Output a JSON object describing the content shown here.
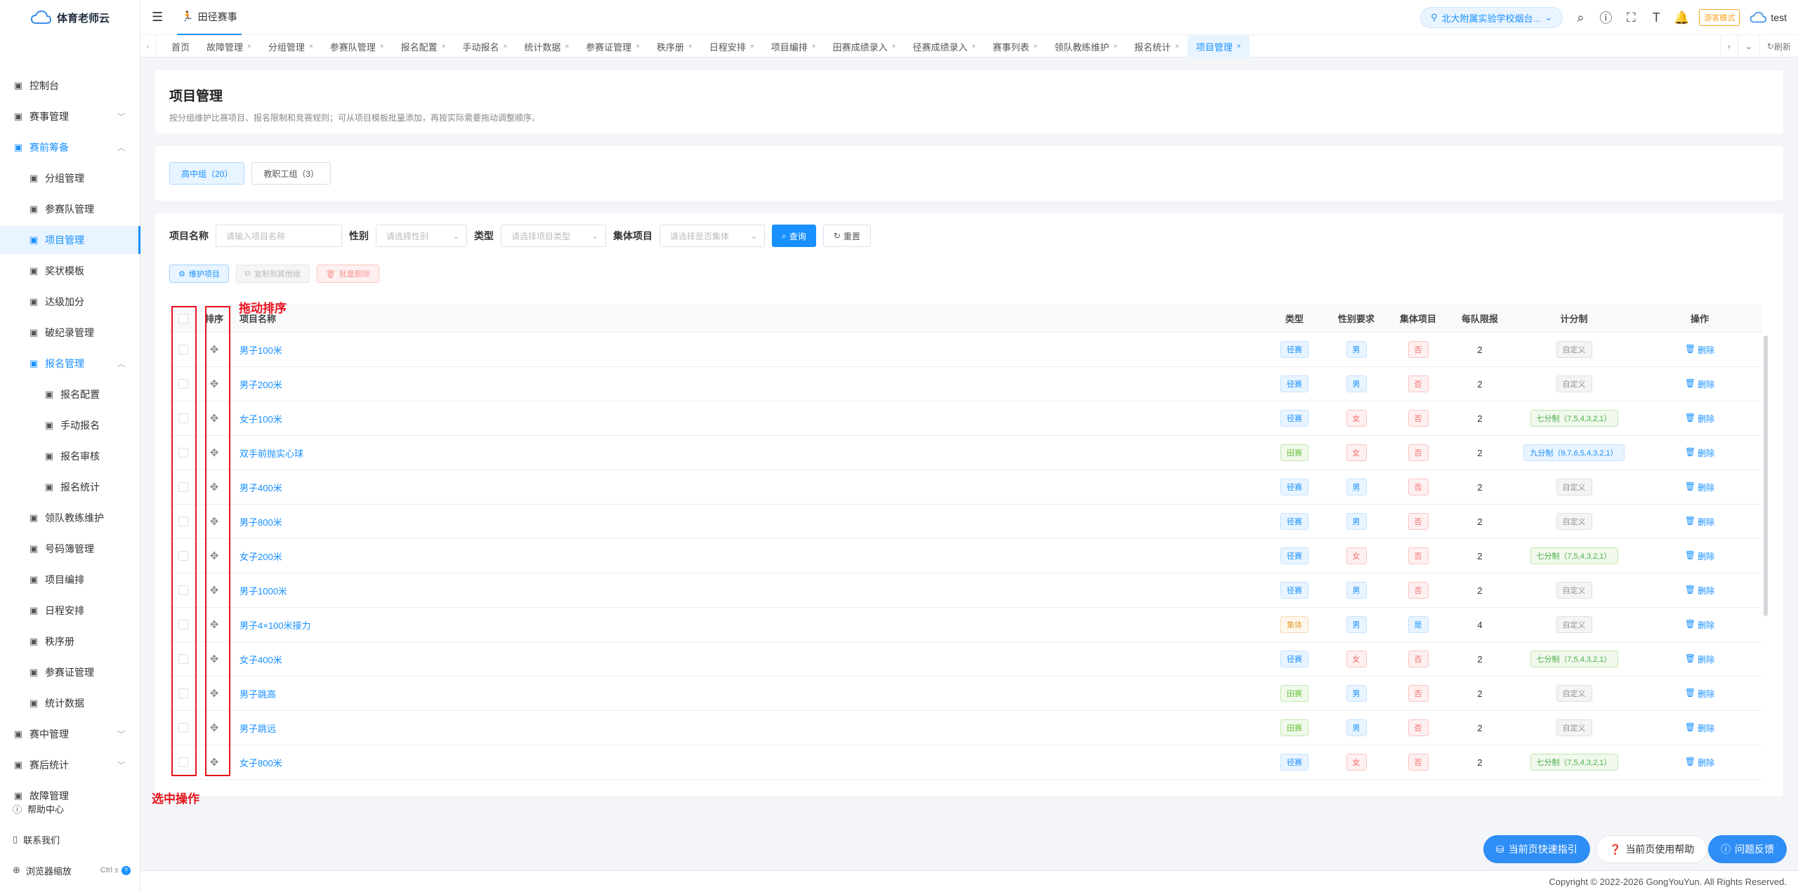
{
  "app": {
    "name": "体育老师云"
  },
  "sidebar": {
    "items": [
      {
        "label": "控制台",
        "icon": "dashboard-icon"
      },
      {
        "label": "赛事管理",
        "icon": "trophy-icon",
        "chevron": "﹀"
      },
      {
        "label": "赛前筹备",
        "icon": "document-icon",
        "chevron": "︿"
      },
      {
        "label": "分组管理",
        "icon": "group-icon"
      },
      {
        "label": "参赛队管理",
        "icon": "team-icon"
      },
      {
        "label": "项目管理",
        "icon": "doc-icon"
      },
      {
        "label": "奖状模板",
        "icon": "certificate-icon"
      },
      {
        "label": "达级加分",
        "icon": "chart-line-icon"
      },
      {
        "label": "破纪录管理",
        "icon": "record-icon"
      },
      {
        "label": "报名管理",
        "icon": "form-icon",
        "chevron": "︿"
      },
      {
        "label": "报名配置",
        "icon": "config-icon"
      },
      {
        "label": "手动报名",
        "icon": "hand-icon"
      },
      {
        "label": "报名审核",
        "icon": "audit-icon"
      },
      {
        "label": "报名统计",
        "icon": "stat-doc-icon"
      },
      {
        "label": "领队教练维护",
        "icon": "coach-icon"
      },
      {
        "label": "号码簿管理",
        "icon": "bib-icon"
      },
      {
        "label": "项目编排",
        "icon": "list-icon"
      },
      {
        "label": "日程安排",
        "icon": "calendar-icon"
      },
      {
        "label": "秩序册",
        "icon": "book-icon"
      },
      {
        "label": "参赛证管理",
        "icon": "card-icon"
      },
      {
        "label": "统计数据",
        "icon": "bar-chart-icon"
      },
      {
        "label": "赛中管理",
        "icon": "clock-icon",
        "chevron": "﹀"
      },
      {
        "label": "赛后统计",
        "icon": "stats-icon",
        "chevron": "﹀"
      },
      {
        "label": "故障管理",
        "icon": "bug-icon"
      }
    ],
    "bottom": {
      "help": "帮助中心",
      "contact": "联系我们",
      "zoom": "浏览器缩放",
      "zoom_shortcut": "Ctrl ±",
      "zoom_help": "?"
    }
  },
  "header": {
    "breadcrumb": "田径赛事",
    "school": "北大附属实验学校烟台...",
    "mode_badge": "游客模式",
    "user": "test"
  },
  "tabs": {
    "items": [
      "首页",
      "故障管理",
      "分组管理",
      "参赛队管理",
      "报名配置",
      "手动报名",
      "统计数据",
      "参赛证管理",
      "秩序册",
      "日程安排",
      "项目编排",
      "田赛成绩录入",
      "径赛成绩录入",
      "赛事列表",
      "领队教练维护",
      "报名统计",
      "项目管理"
    ],
    "refresh": "刷新"
  },
  "page": {
    "title": "项目管理",
    "description": "按分组维护比赛项目、报名限制和竞赛规则；可从项目模板批量添加，再按实际需要拖动调整顺序。"
  },
  "groups": [
    "高中组（20）",
    "教职工组（3）"
  ],
  "filters": {
    "name_label": "项目名称",
    "name_placeholder": "请输入项目名称",
    "gender_label": "性别",
    "gender_placeholder": "请选择性别",
    "type_label": "类型",
    "type_placeholder": "请选择项目类型",
    "team_label": "集体项目",
    "team_placeholder": "请选择是否集体",
    "search": "查询",
    "reset": "重置"
  },
  "actions": {
    "maintain": "维护项目",
    "copy": "复制到其他组",
    "batch_delete": "批量删除"
  },
  "table": {
    "headers": {
      "sort": "排序",
      "name": "项目名称",
      "type": "类型",
      "gender": "性别要求",
      "team": "集体项目",
      "limit": "每队限报",
      "score": "计分制",
      "op": "操作"
    },
    "delete_label": "删除",
    "rows": [
      {
        "name": "男子100米",
        "type": "径赛",
        "gender": "男",
        "team": "否",
        "limit": "2",
        "score": "自定义"
      },
      {
        "name": "男子200米",
        "type": "径赛",
        "gender": "男",
        "team": "否",
        "limit": "2",
        "score": "自定义"
      },
      {
        "name": "女子100米",
        "type": "径赛",
        "gender": "女",
        "team": "否",
        "limit": "2",
        "score": "七分制（7,5,4,3,2,1）"
      },
      {
        "name": "双手前抛实心球",
        "type": "田赛",
        "gender": "女",
        "team": "否",
        "limit": "2",
        "score": "九分制（9,7,6,5,4,3,2,1）"
      },
      {
        "name": "男子400米",
        "type": "径赛",
        "gender": "男",
        "team": "否",
        "limit": "2",
        "score": "自定义"
      },
      {
        "name": "男子800米",
        "type": "径赛",
        "gender": "男",
        "team": "否",
        "limit": "2",
        "score": "自定义"
      },
      {
        "name": "女子200米",
        "type": "径赛",
        "gender": "女",
        "team": "否",
        "limit": "2",
        "score": "七分制（7,5,4,3,2,1）"
      },
      {
        "name": "男子1000米",
        "type": "径赛",
        "gender": "男",
        "team": "否",
        "limit": "2",
        "score": "自定义"
      },
      {
        "name": "男子4×100米接力",
        "type": "集体",
        "gender": "男",
        "team": "是",
        "limit": "4",
        "score": "自定义"
      },
      {
        "name": "女子400米",
        "type": "径赛",
        "gender": "女",
        "team": "否",
        "limit": "2",
        "score": "七分制（7,5,4,3,2,1）"
      },
      {
        "name": "男子跳高",
        "type": "田赛",
        "gender": "男",
        "team": "否",
        "limit": "2",
        "score": "自定义"
      },
      {
        "name": "男子跳远",
        "type": "田赛",
        "gender": "男",
        "team": "否",
        "limit": "2",
        "score": "自定义"
      },
      {
        "name": "女子800米",
        "type": "径赛",
        "gender": "女",
        "team": "否",
        "limit": "2",
        "score": "七分制（7,5,4,3,2,1）"
      }
    ]
  },
  "annotations": {
    "drag_sort": "拖动排序",
    "select_op": "选中操作"
  },
  "float_buttons": {
    "guide": "当前页快速指引",
    "help": "当前页使用帮助",
    "feedback": "问题反馈"
  },
  "footer": {
    "copyright": "Copyright © 2022-2026 GongYouYun. All Rights Reserved."
  },
  "colors": {
    "accent": "#1890ff",
    "annotation": "#e8121d"
  }
}
